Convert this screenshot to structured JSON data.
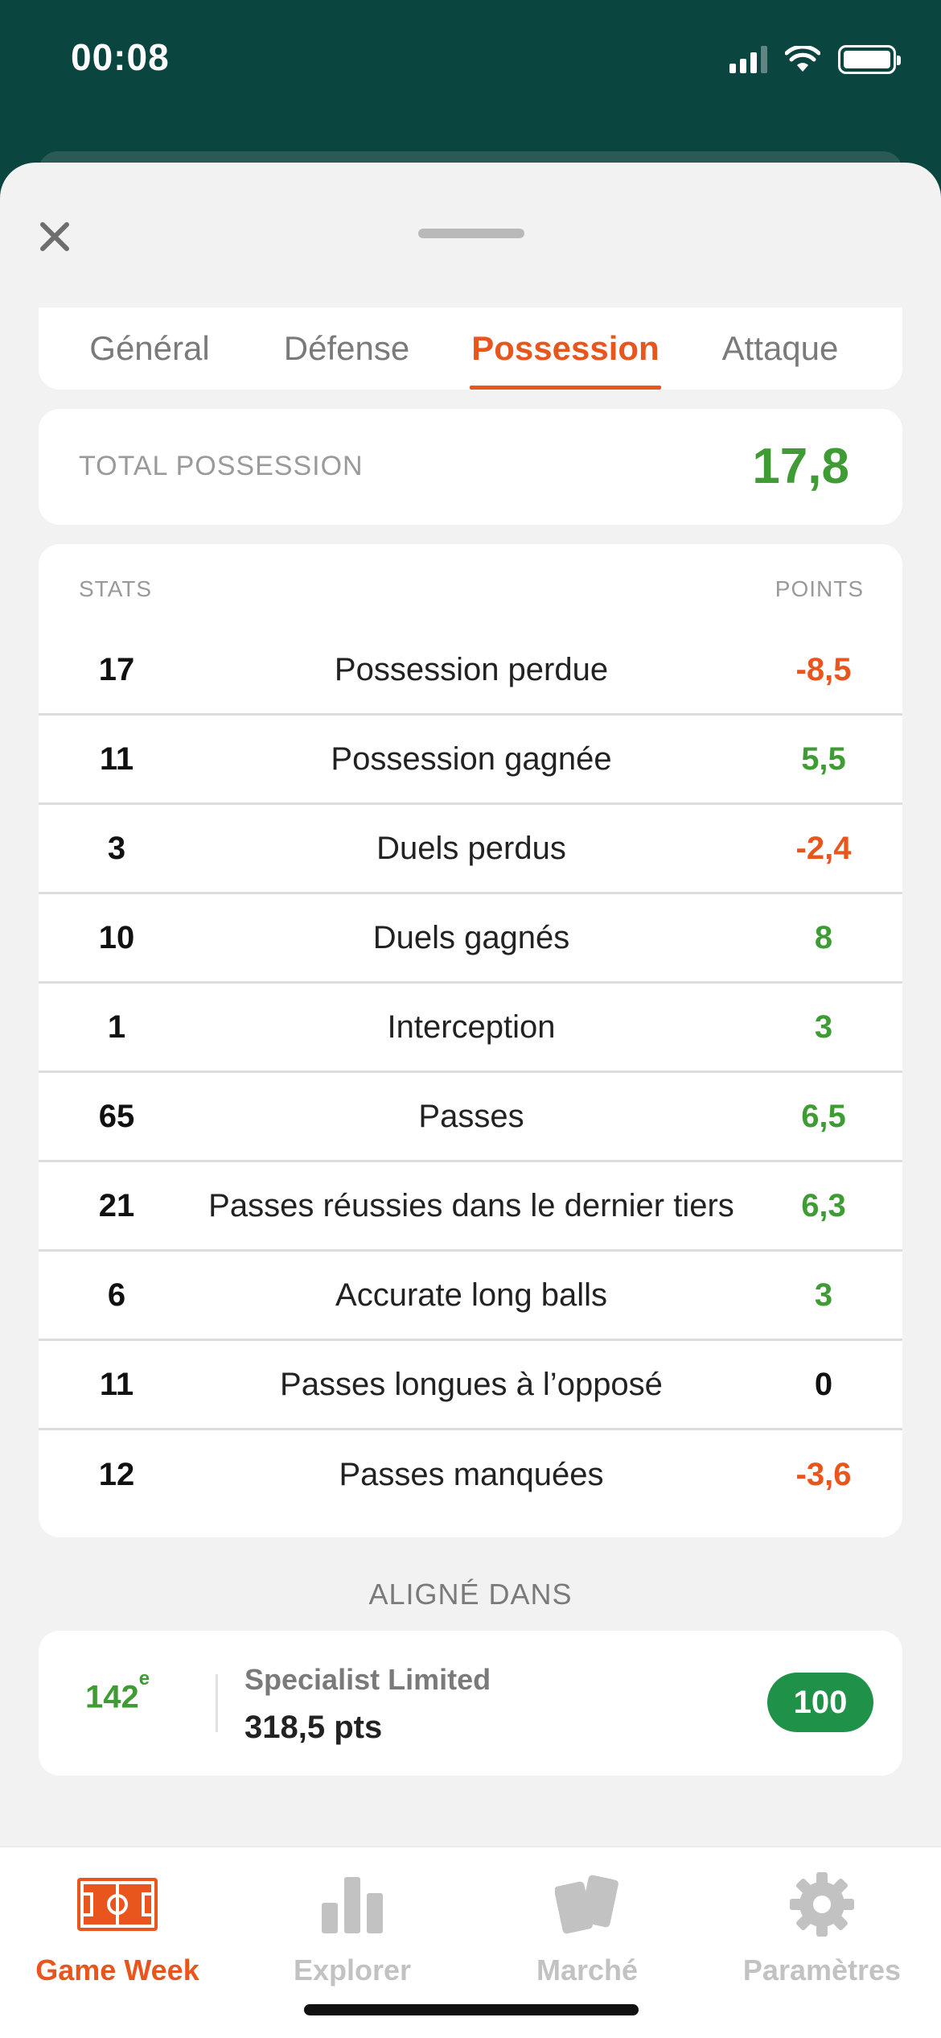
{
  "status_bar": {
    "time": "00:08"
  },
  "tabs": [
    {
      "label": "Général",
      "active": false
    },
    {
      "label": "Défense",
      "active": false
    },
    {
      "label": "Possession",
      "active": true
    },
    {
      "label": "Attaque",
      "active": false
    }
  ],
  "total": {
    "label": "TOTAL POSSESSION",
    "value": "17,8"
  },
  "stats": {
    "header_left": "STATS",
    "header_right": "POINTS",
    "rows": [
      {
        "count": "17",
        "label": "Possession perdue",
        "points": "-8,5",
        "sign": "neg"
      },
      {
        "count": "11",
        "label": "Possession gagnée",
        "points": "5,5",
        "sign": "pos"
      },
      {
        "count": "3",
        "label": "Duels perdus",
        "points": "-2,4",
        "sign": "neg"
      },
      {
        "count": "10",
        "label": "Duels gagnés",
        "points": "8",
        "sign": "pos"
      },
      {
        "count": "1",
        "label": "Interception",
        "points": "3",
        "sign": "pos"
      },
      {
        "count": "65",
        "label": "Passes",
        "points": "6,5",
        "sign": "pos"
      },
      {
        "count": "21",
        "label": "Passes réussies dans le dernier tiers",
        "points": "6,3",
        "sign": "pos"
      },
      {
        "count": "6",
        "label": "Accurate long balls",
        "points": "3",
        "sign": "pos"
      },
      {
        "count": "11",
        "label": "Passes longues à l’opposé",
        "points": "0",
        "sign": "zero"
      },
      {
        "count": "12",
        "label": "Passes manquées",
        "points": "-3,6",
        "sign": "neg"
      }
    ]
  },
  "aligned": {
    "title": "ALIGNÉ DANS",
    "rank": "142",
    "rank_suffix": "e",
    "league_name": "Specialist Limited",
    "league_points": "318,5 pts",
    "badge": "100"
  },
  "nav": [
    {
      "label": "Game Week",
      "icon": "pitch-icon",
      "active": true
    },
    {
      "label": "Explorer",
      "icon": "bar-chart-icon",
      "active": false
    },
    {
      "label": "Marché",
      "icon": "cards-icon",
      "active": false
    },
    {
      "label": "Paramètres",
      "icon": "gear-icon",
      "active": false
    }
  ],
  "colors": {
    "accent": "#e8561e",
    "positive": "#3f9c35",
    "header_bg": "#0a4540",
    "badge": "#1f9148"
  }
}
